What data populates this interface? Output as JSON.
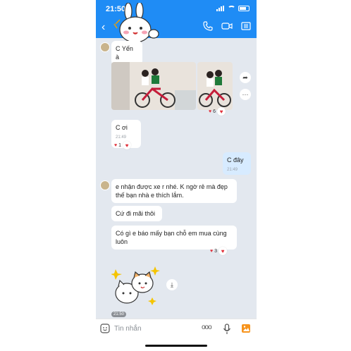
{
  "status": {
    "time": "21:50"
  },
  "header": {},
  "messages": {
    "m1_text": "C Yến à",
    "reaction1_count": "6",
    "m2_text": "C ơi",
    "m2_time": "21:49",
    "reaction2_count": "1",
    "m3_text": "C đây",
    "m3_time": "21:49",
    "m4_text": "e nhận được xe r nhé. K ngờ rẻ mà đẹp thế bạn nhà e thích lắm.",
    "m5_text": "Cứ đi mãi thôi",
    "m6_text": "Có gì e báo mấy bạn chỗ em mua cùng luôn",
    "reaction3_count": "3",
    "sticker_time": "21:50"
  },
  "input": {
    "placeholder": "Tin nhắn",
    "more": "ooo"
  },
  "colors": {
    "header": "#1f8cf5",
    "chat_bg": "#e3e8ef",
    "my_bubble": "#d7ebff",
    "heart": "#e0303a"
  }
}
